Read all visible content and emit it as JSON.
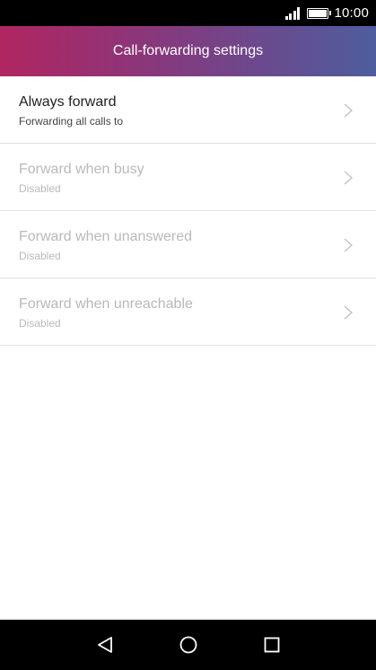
{
  "status_bar": {
    "time": "10:00",
    "icons": [
      "signal-icon",
      "battery-icon"
    ]
  },
  "app_bar": {
    "title": "Call-forwarding settings"
  },
  "settings": [
    {
      "title": "Always forward",
      "subtitle": "Forwarding all calls to",
      "enabled": true
    },
    {
      "title": "Forward when busy",
      "subtitle": "Disabled",
      "enabled": false
    },
    {
      "title": "Forward when unanswered",
      "subtitle": "Disabled",
      "enabled": false
    },
    {
      "title": "Forward when unreachable",
      "subtitle": "Disabled",
      "enabled": false
    }
  ],
  "nav_bar": {
    "icons": [
      "back-icon",
      "home-icon",
      "recents-icon"
    ]
  },
  "colors": {
    "accent_start": "#b02660",
    "accent_end": "#4e5d9e",
    "disabled_text": "#b9b9b9"
  }
}
